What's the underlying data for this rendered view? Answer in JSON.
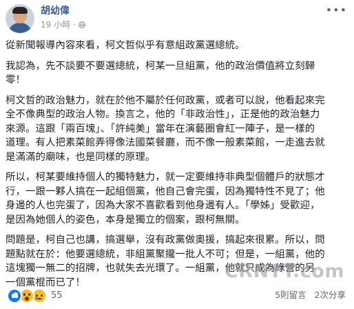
{
  "post_header": {
    "author": "胡幼偉",
    "time": "19 小時",
    "dot": "·",
    "privacy_icon": "globe-icon",
    "more_icon": "more-options-icon"
  },
  "post_body": {
    "paragraphs": [
      "從新聞報導內容來看，柯文哲似乎有意組政黨選總統。",
      "我認為，先不談要不要選總統，柯某一旦組黨，他的政治價值將立刻歸\n零！",
      "柯文哲的政治魅力，就在於他不屬於任何政黨，或者可以說，他看起來完\n全不像典型的政治人物。換言之，他的「非政治性」，正是他的政治魅力\n來源。這跟「兩百塊」、「許純美」當年在演藝圈會紅一陣子，是一樣的\n道理。有人把素菜館弄得像法國菜餐廳，而不像一般素菜館，一走進去就\n是滿滿的廟味，也是同樣的原理。",
      "所以，柯某要維持個人的獨特魅力，就一定要維持非典型個體戶的狀態才\n行，一跟一夥人搞在一起組個黨，他自己會完蛋，因為獨特性不見了；他\n身邊的人也完蛋了，因為大家不喜歡看到他身邊有人。「學姊」受歡迎，\n是因為她個人的姿色，本身是獨立的個案，跟柯無關。",
      "問題是，柯自己也講，搞選舉，沒有政黨做奧援，搞起來很累。所以，問\n題點就在於：他要選總統，非組黨聚攏一批人不可；但是，一組黨，他的\n這塊獨一無二的招牌，也就失去光環了。一組黨，他就只成為綠營的另\n一個黨棍而已了！"
    ]
  },
  "post_footer": {
    "reactions": [
      "like-icon",
      "wow-icon",
      "sad-icon"
    ],
    "reaction_count": "55",
    "comments": "5則留言",
    "shares": "2次分享"
  },
  "watermark": {
    "text": "CRNTT.com"
  },
  "colors": {
    "author": "#385898",
    "text": "#1d2129",
    "meta": "#90949c",
    "like_blue": "#1877f2",
    "emoji_yellow": "#f7b928"
  }
}
